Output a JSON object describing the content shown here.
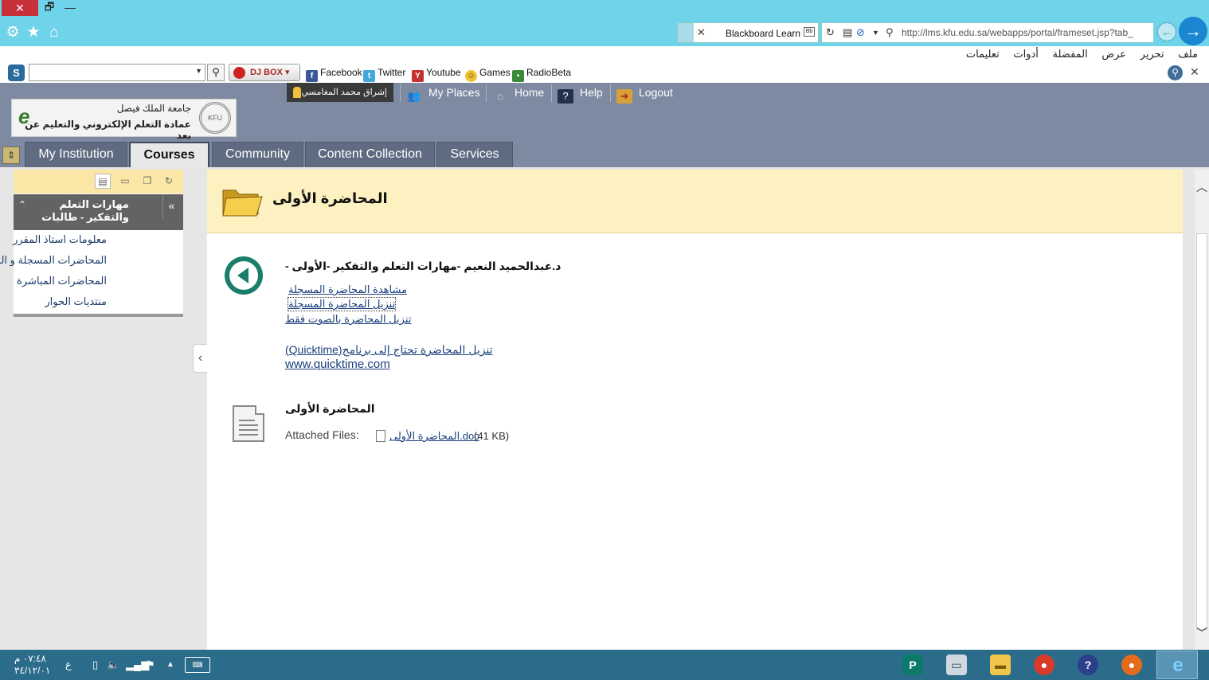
{
  "browser": {
    "tab_title": "Blackboard Learn",
    "url": "http://lms.kfu.edu.sa/webapps/portal/frameset.jsp?tab_",
    "menu": [
      "ملف",
      "تحرير",
      "عرض",
      "المفضلة",
      "أدوات",
      "تعليمات"
    ]
  },
  "toolbar": {
    "djbox": "DJ BOX",
    "links": [
      "Facebook",
      "Twitter",
      "Youtube",
      "Games",
      "RadioBeta"
    ]
  },
  "header": {
    "logo_line1": "جامعة الملك فيصل",
    "logo_line2": "عمادة التعلم الإلكتروني والتعليم عن بعد",
    "user_name": "إشراق محمد المغامسي",
    "top_links": [
      "My Places",
      "Home",
      "Help",
      "Logout"
    ],
    "tabs": [
      "My Institution",
      "Courses",
      "Community",
      "Content Collection",
      "Services"
    ],
    "active_tab": "Courses"
  },
  "course_menu": {
    "title": "مهارات التعلم والتفكير - طالبات",
    "items": [
      "معلومات استاذ المقرر",
      "المحاضرات المسجلة و المحتوى",
      "المحاضرات المباشرة",
      "منتديات الحوار"
    ]
  },
  "page": {
    "title": "المحاضرة الأولى",
    "item1": {
      "title": "د.عبدالحميد النعيم -مهارات التعلم والتفكير -الأولى -",
      "links": [
        "مشاهدة المحاضرة المسجلة",
        "تنزيل المحاضرة المسجلة",
        "تنزيل المحاضرة بالصوت فقط"
      ],
      "note": "تنزيل المحاضرة تحتاج إلى برنامج(Quicktime)",
      "site": "www.quicktime.com"
    },
    "item2": {
      "title": "المحاضرة الأولى",
      "attached_label": "Attached Files:",
      "file_name": "المحاضرة الأولى.doc",
      "file_size": "(41 KB)"
    }
  },
  "taskbar": {
    "time": "٠٧:٤٨ م",
    "date": "٣٤/١٢/٠١",
    "lang": "ع"
  }
}
